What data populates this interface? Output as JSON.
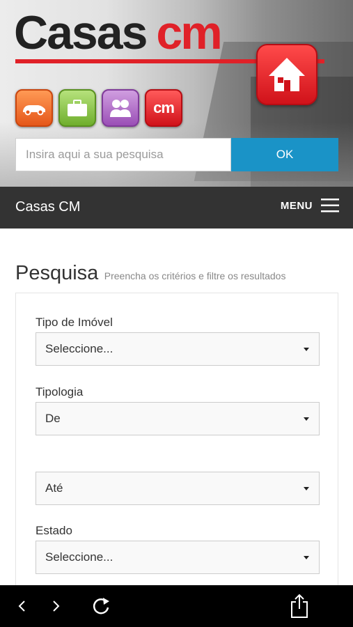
{
  "header": {
    "logo_text_casas": "Casas",
    "logo_text_cm": "cm",
    "app_icons": [
      {
        "name": "car-app-icon",
        "color": "#f2742f"
      },
      {
        "name": "briefcase-app-icon",
        "color": "#8cc63f"
      },
      {
        "name": "people-app-icon",
        "color": "#b368cc"
      },
      {
        "name": "cm-app-icon",
        "color": "#e02128",
        "label": "cm"
      }
    ],
    "home_icon": "home-icon"
  },
  "search": {
    "placeholder": "Insira aqui a sua pesquisa",
    "button_label": "OK"
  },
  "navbar": {
    "brand": "Casas CM",
    "menu_label": "MENU"
  },
  "page": {
    "title": "Pesquisa",
    "subtitle": "Preencha os critérios e filtre os resultados"
  },
  "form": {
    "fields": [
      {
        "label": "Tipo de Imóvel",
        "value": "Seleccione..."
      },
      {
        "label": "Tipologia",
        "value": "De"
      },
      {
        "label": "",
        "value": "Até"
      },
      {
        "label": "Estado",
        "value": "Seleccione..."
      }
    ]
  },
  "colors": {
    "brand_red": "#e02128",
    "accent_blue": "#1a93c7",
    "navbar_bg": "#333333"
  }
}
